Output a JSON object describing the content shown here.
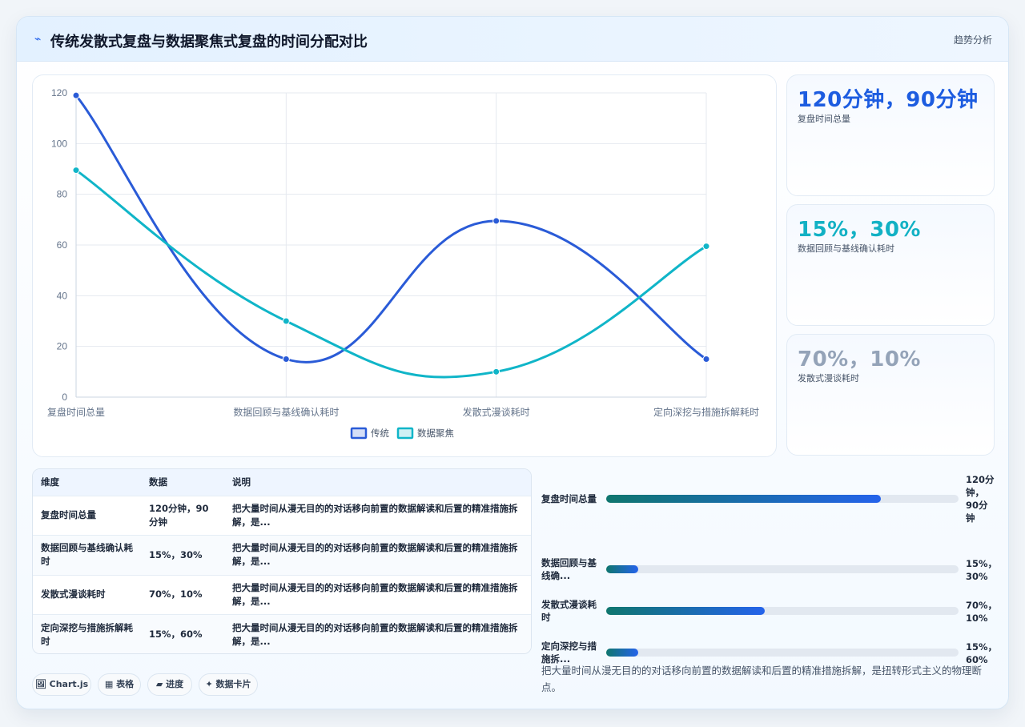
{
  "header": {
    "icon": "trend-icon",
    "title": "传统发散式复盘与数据聚焦式复盘的时间分配对比",
    "tag": "趋势分析"
  },
  "chart_data": {
    "type": "line",
    "categories": [
      "复盘时间总量",
      "数据回顾与基线确认耗时",
      "发散式漫谈耗时",
      "定向深挖与措施拆解耗时"
    ],
    "series": [
      {
        "name": "传统",
        "values": [
          119,
          15,
          69.5,
          15
        ],
        "color": "#2a5bd7"
      },
      {
        "name": "数据聚焦",
        "values": [
          89.5,
          30,
          10,
          59.5
        ],
        "color": "#10b5c8"
      }
    ],
    "y_ticks": [
      "0",
      "20",
      "40",
      "60",
      "80",
      "100",
      "120"
    ],
    "ylim": [
      0,
      120
    ],
    "grid": true,
    "legend_position": "bottom",
    "smooth": true
  },
  "stats": [
    {
      "value": "120分钟，90分钟",
      "label": "复盘时间总量",
      "color": "#1d5ce0"
    },
    {
      "value": "15%，30%",
      "label": "数据回顾与基线确认耗时",
      "color": "#12b1c4"
    },
    {
      "value": "70%，10%",
      "label": "发散式漫谈耗时",
      "color": "#94a3b8"
    }
  ],
  "table": {
    "headers": [
      "维度",
      "数据",
      "说明"
    ],
    "rows": [
      {
        "dim": "复盘时间总量",
        "num": "120分钟，90分钟",
        "desc": "把大量时间从漫无目的的对话移向前置的数据解读和后置的精准措施拆解，是..."
      },
      {
        "dim": "数据回顾与基线确认耗时",
        "num": "15%，30%",
        "desc": "把大量时间从漫无目的的对话移向前置的数据解读和后置的精准措施拆解，是..."
      },
      {
        "dim": "发散式漫谈耗时",
        "num": "70%，10%",
        "desc": "把大量时间从漫无目的的对话移向前置的数据解读和后置的精准措施拆解，是..."
      },
      {
        "dim": "定向深挖与措施拆解耗时",
        "num": "15%，60%",
        "desc": "把大量时间从漫无目的的对话移向前置的数据解读和后置的精准措施拆解，是..."
      }
    ]
  },
  "progress": [
    {
      "label": "复盘时间总量",
      "value": "120分钟，90分钟",
      "fraction": 0.78
    },
    {
      "label": "数据回顾与基线确...",
      "value": "15%，30%",
      "fraction": 0.09
    },
    {
      "label": "发散式漫谈耗时",
      "value": "70%，10%",
      "fraction": 0.45
    },
    {
      "label": "定向深挖与措施拆...",
      "value": "15%，60%",
      "fraction": 0.09
    }
  ],
  "summary": "把大量时间从漫无目的的对话移向前置的数据解读和后置的精准措施拆解，是扭转形式主义的物理断点。",
  "chips": [
    {
      "label": "🖼 Chart.js"
    },
    {
      "label": "▦ 表格"
    },
    {
      "label": "▰ 进度"
    },
    {
      "label": "✦ 数据卡片"
    }
  ]
}
